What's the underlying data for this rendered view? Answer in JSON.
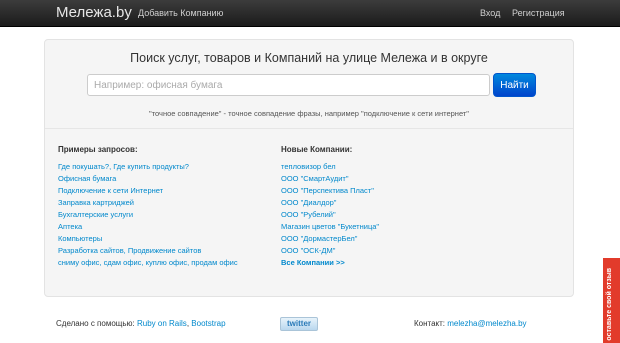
{
  "navbar": {
    "brand": "Мележа.by",
    "add_company": "Добавить Компанию",
    "login": "Вход",
    "register": "Регистрация"
  },
  "hero": {
    "title": "Поиск услуг, товаров и Компаний на улице Мележа и в округе",
    "search_placeholder": "Например: офисная бумага",
    "search_button": "Найти",
    "hint": "\"точное совпадение\" - точное совпадение фразы, например \"подключение к сети интернет\""
  },
  "examples": {
    "title": "Примеры запросов:",
    "items": [
      "Где покушать?, Где купить продукты?",
      "Офисная бумага",
      "Подключение к сети Интернет",
      "Заправка картриджей",
      "Бухгалтерские услуги",
      "Аптека",
      "Компьютеры",
      "Разработка сайтов, Продвижение сайтов",
      "сниму офис, сдам офис, куплю офис, продам офис"
    ]
  },
  "new_companies": {
    "title": "Новые Компании:",
    "items": [
      "тепловизор бел",
      "ООО \"СмартАудит\"",
      "ООО \"Перспектива Пласт\"",
      "ООО \"Диалдор\"",
      "ООО \"Рубелий\"",
      "Магазин цветов \"Букетница\"",
      "ООО \"ДормастерБел\"",
      "ООО \"ОСК-ДМ\""
    ],
    "all_link": "Все Компании >>"
  },
  "footer": {
    "made_with": "Сделано с помощью:",
    "ror": "Ruby on Rails",
    "separator": ",",
    "bootstrap": "Bootstrap",
    "twitter": "twitter",
    "contact_label": "Контакт:",
    "email": "melezha@melezha.by"
  },
  "feedback_tab": "оставьте свой отзыв",
  "colors": {
    "link": "#0088cc",
    "navbar": "#222222",
    "button": "#0066cc",
    "feedback": "#e23b2b"
  }
}
